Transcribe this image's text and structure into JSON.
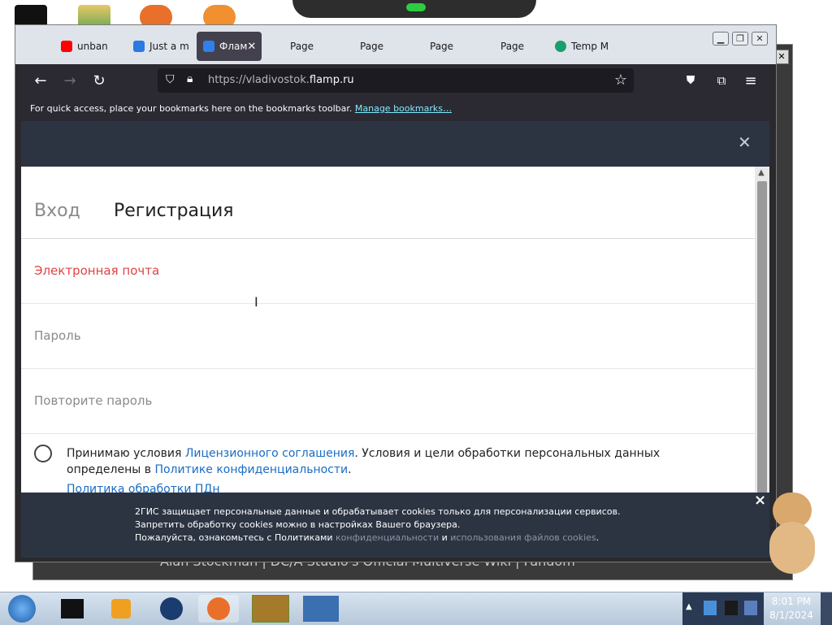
{
  "browser": {
    "tabs": [
      {
        "label": "unban",
        "favicon": "youtube-icon"
      },
      {
        "label": "Just a m",
        "favicon": "link-icon"
      },
      {
        "label": "Флам",
        "favicon": "flamp-icon",
        "active": true
      },
      {
        "label": "Page"
      },
      {
        "label": "Page"
      },
      {
        "label": "Page"
      },
      {
        "label": "Page"
      },
      {
        "label": "Temp M",
        "favicon": "temp-mail-icon"
      }
    ],
    "url_prefix": "https://vladivostok.",
    "url_domain": "flamp.ru",
    "bookmarks_text": "For quick access, place your bookmarks here on the bookmarks toolbar.",
    "manage_bookmarks": "Manage bookmarks…"
  },
  "auth": {
    "tab_login": "Вход",
    "tab_register": "Регистрация",
    "email_placeholder": "Электронная почта",
    "password_placeholder": "Пароль",
    "repeat_placeholder": "Повторите пароль",
    "terms_prefix": "Принимаю условия ",
    "terms_link1": "Лицензионного соглашения",
    "terms_mid": ". Условия и цели обработки персональных данных определены в ",
    "terms_link2": "Политике конфиденциальности",
    "terms_end": ".",
    "terms_link3": "Политика обработки ПДн"
  },
  "cookie_banner": {
    "line1": "2ГИС защищает персональные данные и обрабатывает cookies только для персонализации сервисов.",
    "line2": "Запретить обработку cookies можно в настройках Вашего браузера.",
    "line3_prefix": "Пожалуйста, ознакомьтесь с Политиками ",
    "link1": "конфиденциальности",
    "and": " и ",
    "link2": "использования файлов cookies",
    "end": ".",
    "close": "×"
  },
  "background": {
    "behind_text": "Alan Stockman | DC/A Studio's Official Multiverse Wiki | Fandom"
  },
  "taskbar": {
    "time": "8:01 PM",
    "date": "8/1/2024"
  },
  "colors": {
    "accent_link": "#1a6cc4",
    "email_label": "#e04444",
    "overlay_bg": "#2c3442"
  }
}
